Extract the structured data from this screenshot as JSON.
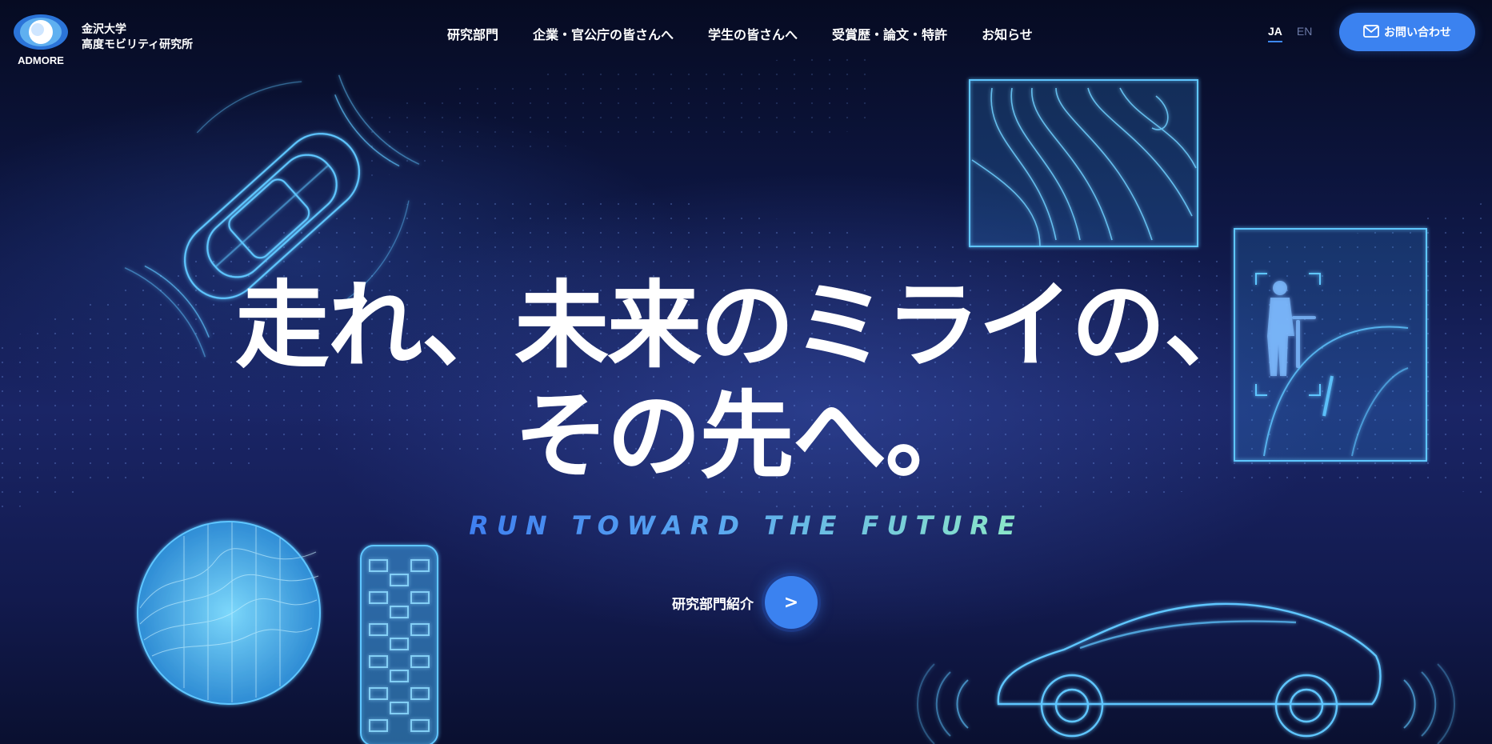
{
  "header": {
    "logo_text": "ADMORE",
    "org_line1": "金沢大学",
    "org_line2": "高度モビリティ研究所"
  },
  "nav": {
    "items": [
      {
        "label": "研究部門"
      },
      {
        "label": "企業・官公庁の皆さんへ"
      },
      {
        "label": "学生の皆さんへ"
      },
      {
        "label": "受賞歴・論文・特許"
      },
      {
        "label": "お知らせ"
      }
    ]
  },
  "lang": {
    "ja": "JA",
    "en": "EN",
    "selected": "JA"
  },
  "contact": {
    "label": "お問い合わせ",
    "icon": "mail-icon"
  },
  "hero": {
    "headline_line1": "走れ、未来のミライの、",
    "headline_line2": "その先へ。",
    "tagline": "RUN TOWARD THE FUTURE",
    "cta_label": "研究部門紹介",
    "cta_arrow": ">"
  },
  "colors": {
    "accent": "#3b82f0",
    "glow": "#5fc6ff",
    "bg_dark": "#060b22"
  }
}
